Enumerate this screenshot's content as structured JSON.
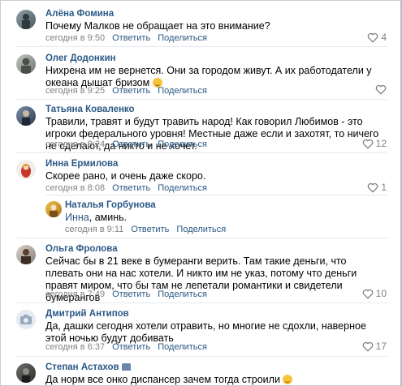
{
  "comments": [
    {
      "name": "Алёна Фомина",
      "text": "Почему Малков не обращает на это внимание?",
      "time": "сегодня в 9:50",
      "reply": "Ответить",
      "share": "Поделиться",
      "likes": "4"
    },
    {
      "name": "Олег Додонкин",
      "text": "Нихрена им не вернется. Они за городом живут. А их работодатели у океана дышат бризом",
      "time": "сегодня в 9:25",
      "reply": "Ответить",
      "share": "Поделиться",
      "likes": ""
    },
    {
      "name": "Татьяна Коваленко",
      "text": "Травили, травят и будут травить народ! Как говорил Любимов - это игроки федерального уровня! Местные даже если и захотят, то ничего не сделают, да никто и не хочет.",
      "time": "сегодня в 8:24",
      "reply": "Ответить",
      "share": "Поделиться",
      "likes": "12"
    },
    {
      "name": "Инна Ермилова",
      "text": "Скорее рано, и очень даже скоро.",
      "time": "сегодня в 8:08",
      "reply": "Ответить",
      "share": "Поделиться",
      "likes": "1"
    },
    {
      "name": "Наталья Горбунова",
      "mention": "Инна",
      "text": ", аминь.",
      "time": "сегодня в 9:11",
      "reply": "Ответить",
      "share": "Поделиться",
      "likes": ""
    },
    {
      "name": "Ольга Фролова",
      "text": "Сейчас бы в 21 веке в бумеранги верить. Там такие деньги, что плевать они на нас хотели. И никто им не указ, потому что деньги правят миром, что бы там не лепетали романтики и свидетели бумерангов",
      "time": "сегодня в 7:49",
      "reply": "Ответить",
      "share": "Поделиться",
      "likes": "10"
    },
    {
      "name": "Дмитрий Антипов",
      "text": "Да, дашки сегодня хотели отравить, но многие не сдохли, наверное этой ночью будут добивать",
      "time": "сегодня в 6:37",
      "reply": "Ответить",
      "share": "Поделиться",
      "likes": "17"
    },
    {
      "name": "Степан Астахов",
      "text": "Да норм все онко диспансер зачем тогда строили",
      "time": "",
      "reply": "",
      "share": "",
      "likes": ""
    }
  ]
}
